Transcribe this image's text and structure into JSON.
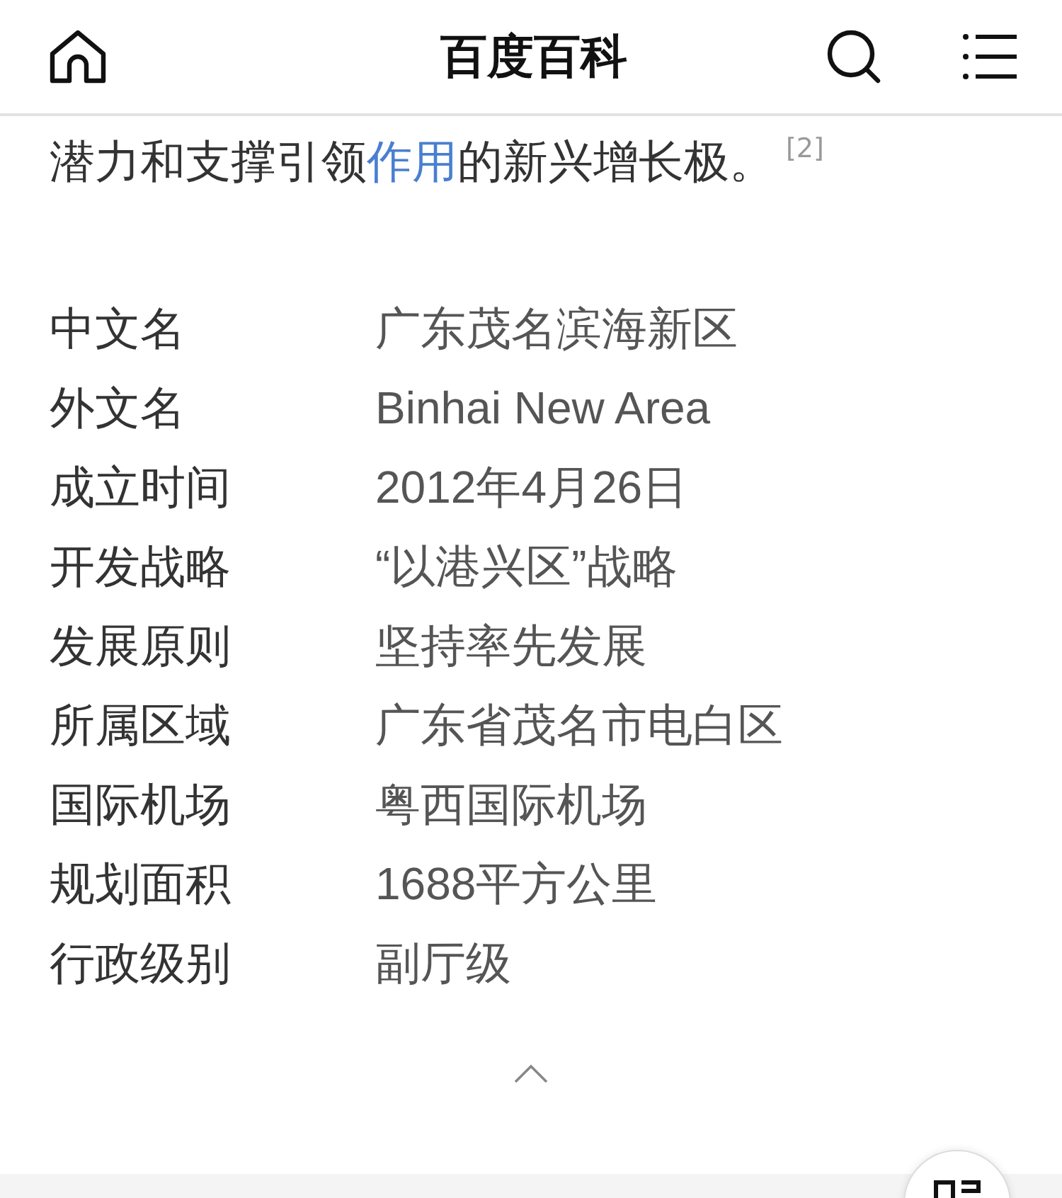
{
  "header": {
    "title": "百度百科"
  },
  "intro": {
    "parts": [
      {
        "kind": "text",
        "text": "潜力和支撑引领"
      },
      {
        "kind": "link",
        "text": "作用"
      },
      {
        "kind": "text",
        "text": "的新兴增长极。"
      }
    ],
    "footnote": "[2]"
  },
  "infobox": [
    {
      "label": "中文名",
      "value": "广东茂名滨海新区"
    },
    {
      "label": "外文名",
      "value": "Binhai New Area"
    },
    {
      "label": "成立时间",
      "value": "2012年4月26日"
    },
    {
      "label": "开发战略",
      "value": "“以港兴区”战略"
    },
    {
      "label": "发展原则",
      "value": "坚持率先发展"
    },
    {
      "label": "所属区域",
      "value": "广东省茂名市电白区"
    },
    {
      "label": "国际机场",
      "value": "粤西国际机场"
    },
    {
      "label": "规划面积",
      "value": "1688平方公里"
    },
    {
      "label": "行政级别",
      "value": "副厅级"
    }
  ]
}
